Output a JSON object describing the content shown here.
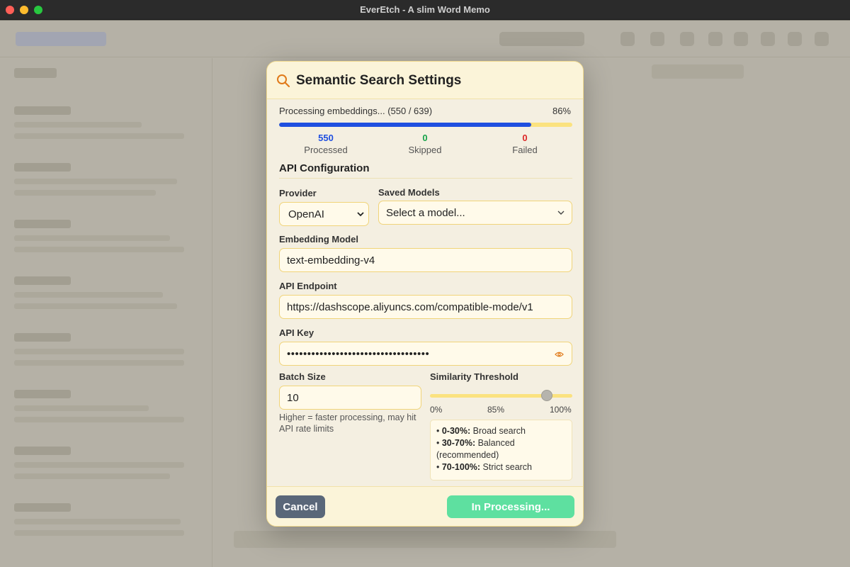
{
  "window": {
    "title": "EverEtch - A slim Word Memo"
  },
  "dialog": {
    "title": "Semantic Search Settings",
    "icon": "search-icon",
    "progress": {
      "label": "Processing embeddings... (550 / 639)",
      "percent_text": "86%",
      "processed": 550,
      "total": 639
    },
    "stats": [
      {
        "value": "550",
        "label": "Processed",
        "color": "#1f4fe0"
      },
      {
        "value": "0",
        "label": "Skipped",
        "color": "#16a34a"
      },
      {
        "value": "0",
        "label": "Failed",
        "color": "#dc2626"
      }
    ],
    "api_section_title": "API Configuration",
    "provider": {
      "label": "Provider",
      "value": "OpenAI"
    },
    "saved_models": {
      "label": "Saved Models",
      "value": "Select a model..."
    },
    "embedding_model": {
      "label": "Embedding Model",
      "value": "text-embedding-v4"
    },
    "api_endpoint": {
      "label": "API Endpoint",
      "value": "https://dashscope.aliyuncs.com/compatible-mode/v1"
    },
    "api_key": {
      "label": "API Key",
      "value": "•••••••••••••••••••••••••••••••••••"
    },
    "batch_size": {
      "label": "Batch Size",
      "value": "10",
      "help": "Higher = faster processing, may hit API rate limits"
    },
    "similarity": {
      "label": "Similarity Threshold",
      "value_percent": 85,
      "ticks": [
        "0%",
        "85%",
        "100%"
      ],
      "info": [
        {
          "range": "0-30%:",
          "desc": "Broad search"
        },
        {
          "range": "30-70%:",
          "desc": "Balanced (recommended)"
        },
        {
          "range": "70-100%:",
          "desc": "Strict search"
        }
      ]
    },
    "buttons": {
      "cancel": "Cancel",
      "process": "In Processing..."
    }
  }
}
